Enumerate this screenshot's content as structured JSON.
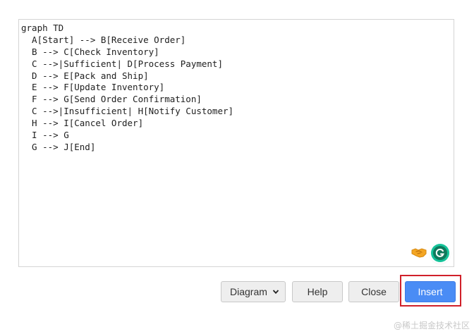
{
  "editor": {
    "lines": [
      "graph TD",
      "  A[Start] --> B[Receive Order]",
      "  B --> C[Check Inventory]",
      "  C -->|Sufficient| D[Process Payment]",
      "  D --> E[Pack and Ship]",
      "  E --> F[Update Inventory]",
      "  F --> G[Send Order Confirmation]",
      "  C -->|Insufficient| H[Notify Customer]",
      "  H --> I[Cancel Order]",
      "  I --> G",
      "  G --> J[End]"
    ]
  },
  "icons": {
    "handshake": "handshake-icon",
    "grammarly": "grammarly-icon",
    "chevron": "chevron-down-icon"
  },
  "toolbar": {
    "type_select_value": "Diagram",
    "help_label": "Help",
    "close_label": "Close",
    "insert_label": "Insert"
  },
  "watermark": "@稀土掘金技术社区",
  "colors": {
    "accent": "#4a8cf5",
    "highlight": "#d0202a",
    "grammarly": "#15c39a"
  }
}
